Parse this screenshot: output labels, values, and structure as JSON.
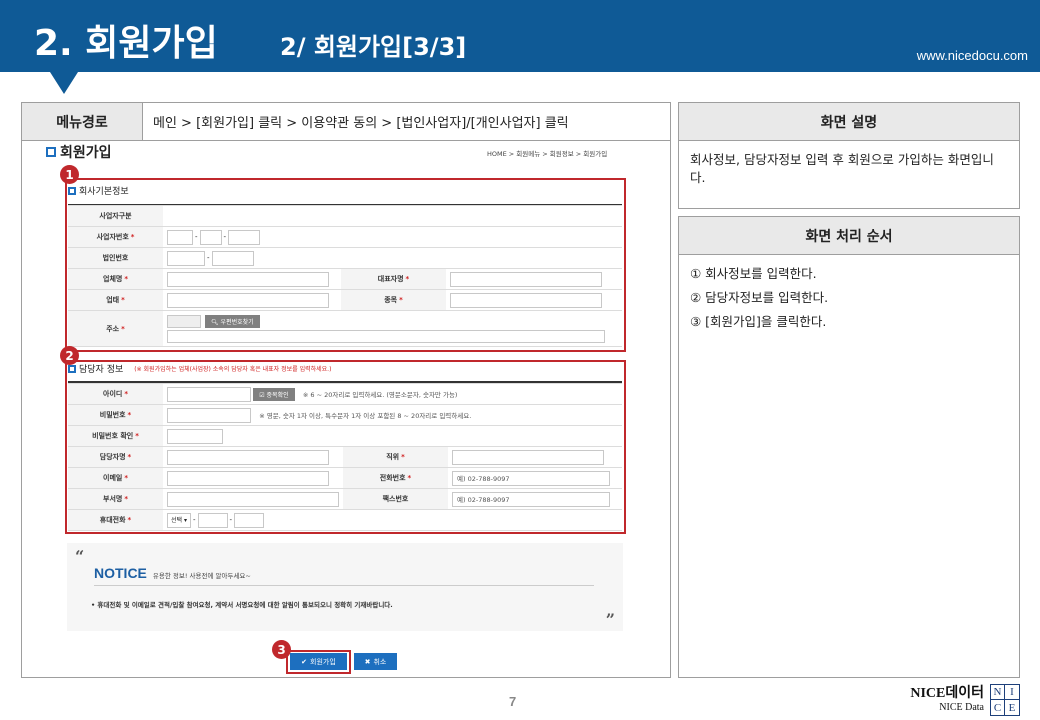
{
  "header": {
    "title": "2. 회원가입",
    "subtitle": "2/ 회원가입[3/3]",
    "url": "www.nicedocu.com",
    "color": "#0f5a96"
  },
  "menu": {
    "label": "메뉴경로",
    "path": "메인 > [회원가입] 클릭 > 이용약관 동의 > [법인사업자]/[개인사업자] 클릭"
  },
  "form": {
    "title": "회원가입",
    "breadcrumb": "HOME > 회원메뉴 > 회원정보 > 회원가입",
    "section1": {
      "badge": "1",
      "title": "회사기본정보",
      "rows": {
        "biz_type": "사업자구분",
        "biz_no": "사업자번호",
        "corp_no": "법인번호",
        "company": "업체명",
        "ceo": "대표자명",
        "biz_kind": "업태",
        "biz_item": "종목",
        "address": "주소"
      },
      "zip_button": "우편번호찾기"
    },
    "section2": {
      "badge": "2",
      "title": "담당자 정보",
      "note": "(※ 회원가입하는 업체(사업장) 소속의 담당자 혹은 내표자 정보를 입력하세요.)",
      "rows": {
        "id": "아이디",
        "password": "비밀번호",
        "password_confirm": "비밀번호 확인",
        "manager": "담당자명",
        "position": "직위",
        "email": "이메일",
        "phone": "전화번호",
        "dept": "부서명",
        "fax": "팩스번호",
        "mobile": "휴대전화"
      },
      "dup_button": "중복확인",
      "id_hint": "※ 6 ~ 20자리로 입력하세요. (영문소문자, 숫자만 가능)",
      "pw_hint": "※ 영문, 숫자 1자 이상, 특수문자 1자 이상 포함된 8 ~ 20자리로 입력하세요.",
      "phone_placeholder": "예) 02-788-9097",
      "fax_placeholder": "예) 02-788-9097",
      "mobile_select": "선택"
    },
    "required_mark": "*"
  },
  "notice": {
    "title": "NOTICE",
    "subtitle": "유용한 정보! 사용전에 알아두세요~",
    "text": "• 휴대전화 및 이메일로 견적/입찰 참여요청, 계약서 서명요청에 대한 알림이 통보되오니 정확히 기재바랍니다."
  },
  "buttons": {
    "badge": "3",
    "join": "회원가입",
    "cancel": "취소"
  },
  "right": {
    "desc_title": "화면 설명",
    "desc_text": "회사정보, 담당자정보 입력 후 회원으로 가입하는 화면입니다.",
    "proc_title": "화면 처리 순서",
    "steps": [
      "① 회사정보를 입력한다.",
      "② 담당자정보를 입력한다.",
      "③ [회원가입]을 클릭한다."
    ]
  },
  "page_number": "7",
  "logo": {
    "main": "NICE데이터",
    "sub": "NICE Data",
    "grid": [
      "N",
      "I",
      "C",
      "E"
    ]
  }
}
